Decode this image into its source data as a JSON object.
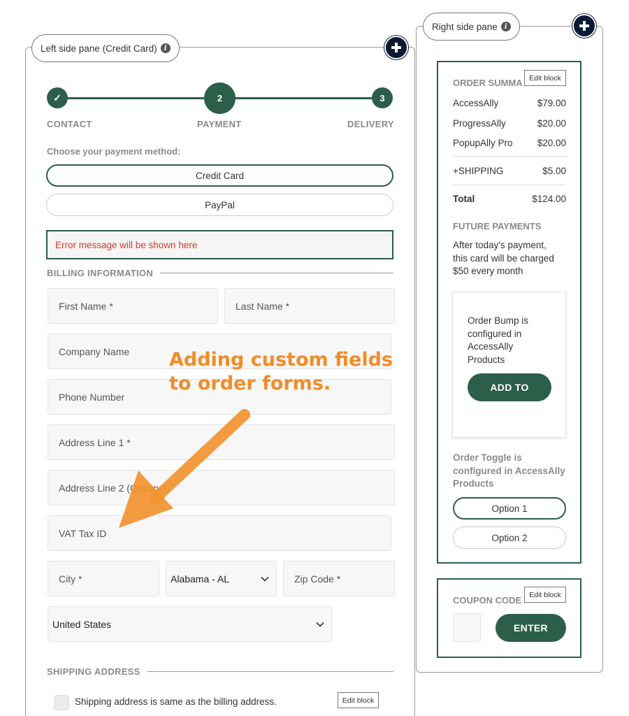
{
  "left_pane": {
    "label": "Left side pane (Credit Card)",
    "steps": [
      {
        "marker": "✓",
        "label": "CONTACT"
      },
      {
        "marker": "2",
        "label": "PAYMENT"
      },
      {
        "marker": "3",
        "label": "DELIVERY"
      }
    ],
    "payment_prompt": "Choose your payment method:",
    "payment_methods": [
      "Credit Card",
      "PayPal"
    ],
    "error_message": "Error message will be shown here",
    "billing_heading": "BILLING INFORMATION",
    "fields": {
      "first_name": "First Name *",
      "last_name": "Last Name *",
      "company": "Company Name",
      "phone": "Phone Number",
      "address1": "Address Line 1 *",
      "address2": "Address Line 2 (Optional)",
      "vat": "VAT Tax ID",
      "city": "City *",
      "state": "Alabama - AL",
      "zip": "Zip Code *",
      "country": "United States"
    },
    "shipping_heading": "SHIPPING ADDRESS",
    "shipping_checkbox_label": "Shipping address is same as the billing address.",
    "edit_block": "Edit block"
  },
  "annotation": {
    "line1": "Adding custom fields",
    "line2": "to order forms.",
    "color": "#f28c28"
  },
  "right_pane": {
    "label": "Right side pane",
    "order_summary": {
      "heading": "ORDER SUMMA",
      "edit_block": "Edit block",
      "items": [
        {
          "name": "AccessAlly",
          "price": "$79.00"
        },
        {
          "name": "ProgressAlly",
          "price": "$20.00"
        },
        {
          "name": "PopupAlly Pro",
          "price": "$20.00"
        }
      ],
      "shipping": {
        "name": "+SHIPPING",
        "price": "$5.00"
      },
      "total": {
        "name": "Total",
        "price": "$124.00"
      }
    },
    "future_payments": {
      "heading": "FUTURE PAYMENTS",
      "line1": "After today's payment,",
      "line2": "this card will be charged",
      "line3": "$50 every month"
    },
    "order_bump": {
      "line1": "Order Bump is",
      "line2": "configured in",
      "line3": "AccessAlly",
      "line4": "Products",
      "button": "ADD TO"
    },
    "order_toggle": {
      "line1": "Order Toggle is",
      "line2": "configured in AccessAlly",
      "line3": "Products",
      "options": [
        "Option 1",
        "Option 2"
      ]
    },
    "coupon": {
      "heading": "COUPON CODE",
      "edit_block": "Edit block",
      "button": "ENTER"
    }
  },
  "colors": {
    "brand_green": "#2c5e4a",
    "error_red": "#d93a2b",
    "plus_navy": "#0b1a33"
  }
}
